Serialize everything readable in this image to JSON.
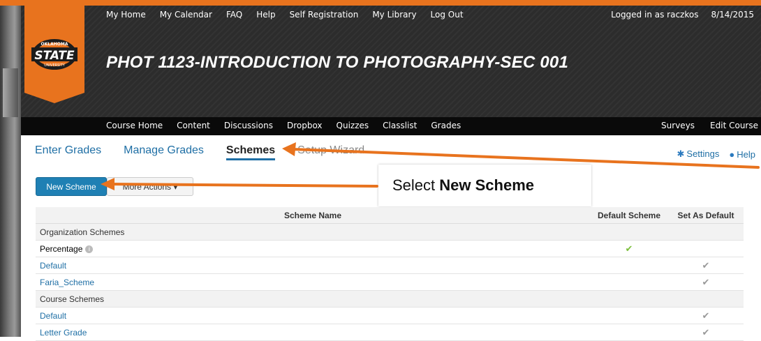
{
  "topnav": {
    "items": [
      "My Home",
      "My Calendar",
      "FAQ",
      "Help",
      "Self Registration",
      "My Library",
      "Log Out"
    ]
  },
  "user": {
    "logged_in": "Logged in as raczkos",
    "date": "8/14/2015"
  },
  "logo": {
    "line1": "OKLAHOMA",
    "line2": "STATE",
    "line3": "UNIVERSITY"
  },
  "course": {
    "title": "PHOT 1123-INTRODUCTION TO PHOTOGRAPHY-SEC 001"
  },
  "navbar": {
    "items": [
      "Course Home",
      "Content",
      "Discussions",
      "Dropbox",
      "Quizzes",
      "Classlist",
      "Grades"
    ],
    "right": [
      "Surveys",
      "Edit Course"
    ]
  },
  "subtabs": [
    "Enter Grades",
    "Manage Grades",
    "Schemes",
    "Setup Wizard"
  ],
  "sub_right": {
    "settings": "Settings",
    "help": "Help"
  },
  "buttons": {
    "new_scheme": "New Scheme",
    "more_actions": "More Actions"
  },
  "callout": {
    "prefix": "Select ",
    "bold": "New Scheme"
  },
  "table": {
    "headers": [
      "Scheme Name",
      "Default Scheme",
      "Set As Default"
    ],
    "org_group": "Organization Schemes",
    "org_rows": [
      "Percentage",
      "Default",
      "Faria_Scheme"
    ],
    "course_group": "Course Schemes",
    "course_rows": [
      "Default",
      "Letter Grade"
    ]
  },
  "colors": {
    "accent_orange": "#e8731e",
    "link_blue": "#1f6fa5",
    "button_blue": "#1f80b4",
    "check_green": "#7bbf3a"
  }
}
